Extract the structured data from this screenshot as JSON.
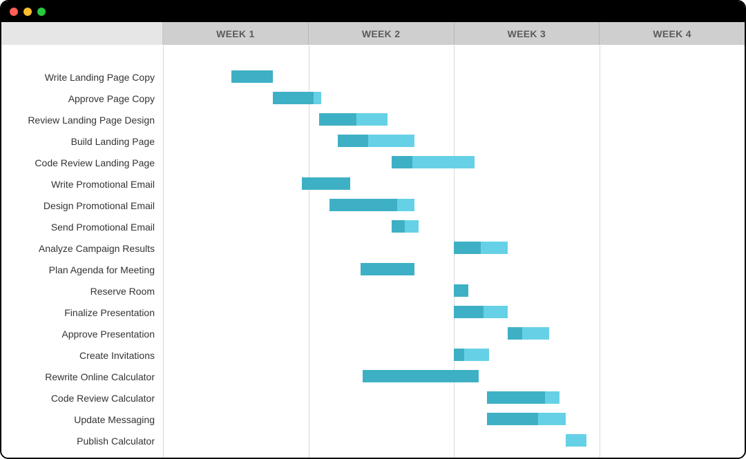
{
  "chart_data": {
    "type": "gantt",
    "x_unit": "days",
    "x_range": [
      0,
      28
    ],
    "columns": [
      "WEEK 1",
      "WEEK 2",
      "WEEK 3",
      "WEEK 4"
    ],
    "tasks": [
      {
        "label": "Write Landing Page Copy",
        "start": 3.3,
        "duration": 2.0,
        "progress": 1.0
      },
      {
        "label": "Approve Page Copy",
        "start": 5.3,
        "duration": 2.3,
        "progress": 0.85
      },
      {
        "label": "Review Landing Page Design",
        "start": 7.5,
        "duration": 3.3,
        "progress": 0.55
      },
      {
        "label": "Build Landing Page",
        "start": 8.4,
        "duration": 3.7,
        "progress": 0.4
      },
      {
        "label": "Code Review Landing Page",
        "start": 11.0,
        "duration": 4.0,
        "progress": 0.25
      },
      {
        "label": "Write Promotional Email",
        "start": 6.7,
        "duration": 2.3,
        "progress": 1.0
      },
      {
        "label": "Design Promotional Email",
        "start": 8.0,
        "duration": 4.1,
        "progress": 0.8
      },
      {
        "label": "Send Promotional Email",
        "start": 11.0,
        "duration": 1.3,
        "progress": 0.5
      },
      {
        "label": "Analyze Campaign Results",
        "start": 14.0,
        "duration": 2.6,
        "progress": 0.5
      },
      {
        "label": "Plan Agenda for Meeting",
        "start": 9.5,
        "duration": 2.6,
        "progress": 1.0
      },
      {
        "label": "Reserve Room",
        "start": 14.0,
        "duration": 0.7,
        "progress": 1.0
      },
      {
        "label": "Finalize Presentation",
        "start": 14.0,
        "duration": 2.6,
        "progress": 0.55
      },
      {
        "label": "Approve Presentation",
        "start": 16.6,
        "duration": 2.0,
        "progress": 0.35
      },
      {
        "label": "Create Invitations",
        "start": 14.0,
        "duration": 1.7,
        "progress": 0.3
      },
      {
        "label": "Rewrite Online Calculator",
        "start": 9.6,
        "duration": 5.6,
        "progress": 1.0
      },
      {
        "label": "Code Review Calculator",
        "start": 15.6,
        "duration": 3.5,
        "progress": 0.8
      },
      {
        "label": "Update Messaging",
        "start": 15.6,
        "duration": 3.8,
        "progress": 0.65
      },
      {
        "label": "Publish Calculator",
        "start": 19.4,
        "duration": 1.0,
        "progress": 0.0
      }
    ]
  },
  "colors": {
    "bar": "#66d1e6",
    "progress": "#3eb0c5",
    "header_bg": "#cfcfcf",
    "header_text": "#5a5a5a"
  }
}
